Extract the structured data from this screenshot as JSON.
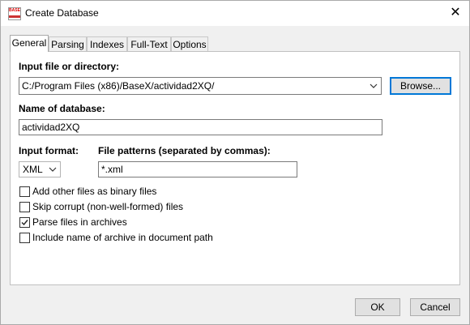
{
  "window": {
    "title": "Create Database",
    "icon_text": "BASE",
    "close_glyph": "✕"
  },
  "tabs": [
    {
      "label": "General",
      "active": true
    },
    {
      "label": "Parsing",
      "active": false
    },
    {
      "label": "Indexes",
      "active": false
    },
    {
      "label": "Full-Text",
      "active": false
    },
    {
      "label": "Options",
      "active": false
    }
  ],
  "general": {
    "input_label": "Input file or directory:",
    "input_value": "C:/Program Files (x86)/BaseX/actividad2XQ/",
    "browse_label": "Browse...",
    "name_label": "Name of database:",
    "name_value": "actividad2XQ",
    "format_label": "Input format:",
    "format_value": "XML",
    "patterns_label": "File patterns (separated by commas):",
    "patterns_value": "*.xml",
    "checkboxes": [
      {
        "label": "Add other files as binary files",
        "checked": false
      },
      {
        "label": "Skip corrupt (non-well-formed) files",
        "checked": false
      },
      {
        "label": "Parse files in archives",
        "checked": true
      },
      {
        "label": "Include name of archive in document path",
        "checked": false
      }
    ]
  },
  "footer": {
    "ok_label": "OK",
    "cancel_label": "Cancel"
  },
  "icons": {
    "dropdown": "chevron-down-icon",
    "check": "checkmark-icon"
  }
}
